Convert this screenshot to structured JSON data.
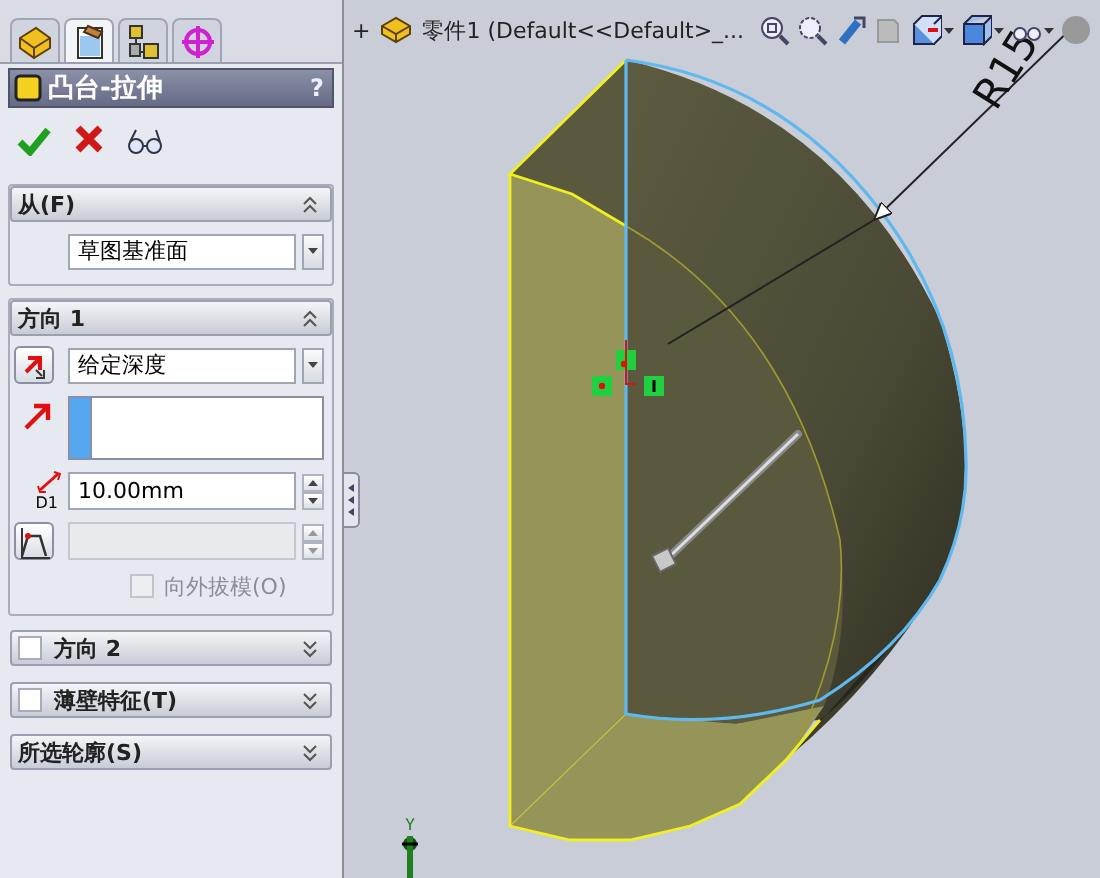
{
  "tabs": [
    {
      "kind": "feature",
      "selected": false
    },
    {
      "kind": "property",
      "selected": true
    },
    {
      "kind": "config",
      "selected": false
    },
    {
      "kind": "dimxpert",
      "selected": false
    }
  ],
  "feature_panel": {
    "title": "凸台-拉伸",
    "help": "?"
  },
  "actions": [
    {
      "kind": "ok"
    },
    {
      "kind": "cancel"
    },
    {
      "kind": "preview"
    }
  ],
  "groups": [
    {
      "title": "从(F)",
      "expanded": true,
      "rows": [
        {
          "kind": "dropdown",
          "value": "草图基准面"
        }
      ]
    },
    {
      "title": "方向 1",
      "expanded": true,
      "rows": [
        {
          "kind": "dropdown",
          "value": "给定深度"
        },
        {
          "kind": "selection"
        },
        {
          "kind": "spin",
          "icon_label": "D1",
          "value": "10.00mm",
          "disabled": false
        },
        {
          "kind": "spin",
          "disabled": true
        },
        {
          "kind": "checkbox",
          "label": "向外拔模(O)",
          "checked": false,
          "disabled": true
        }
      ]
    },
    {
      "title": "方向 2",
      "expanded": false,
      "checked": false
    },
    {
      "title": "薄壁特征(T)",
      "expanded": false,
      "checked": false
    },
    {
      "title": "所选轮廓(S)",
      "expanded": false
    }
  ],
  "graphics": {
    "expand": "+",
    "document_title": "零件1 (Default<<Default>_...",
    "dimension": "R15",
    "axis_label": "Y"
  }
}
